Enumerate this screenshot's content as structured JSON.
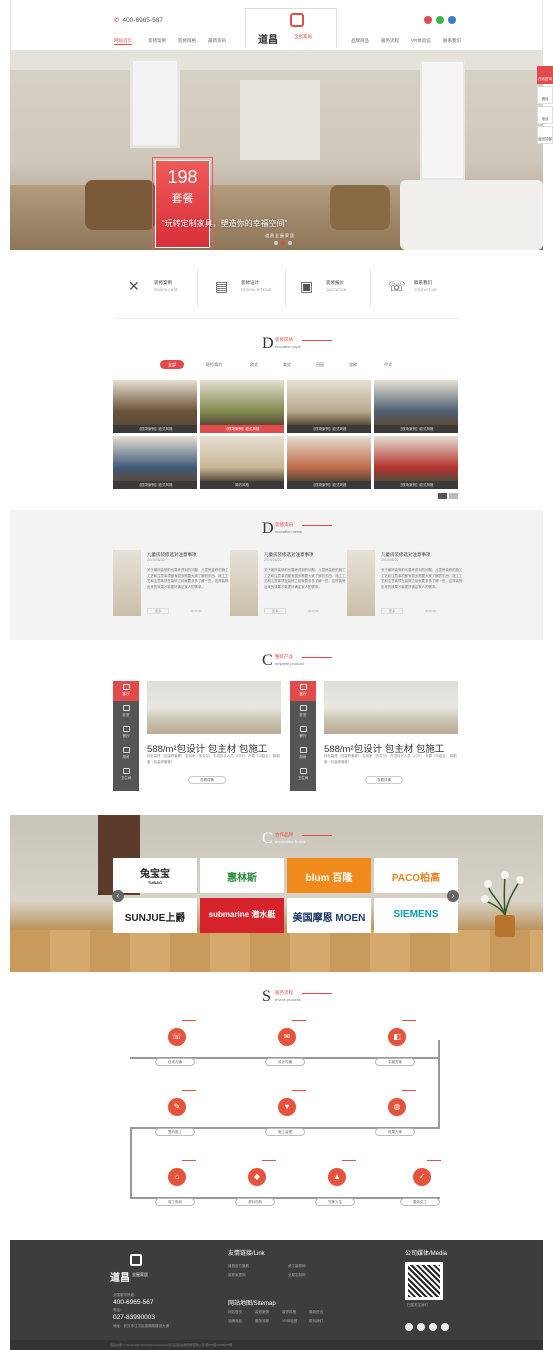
{
  "header": {
    "phone": "400-6965-567",
    "logo_text": "道昌",
    "logo_sub": "全屋家居",
    "nav_left": [
      "网站首页",
      "装修案例",
      "装修风格",
      "最新资讯"
    ],
    "nav_right": [
      "品牌商品",
      "服务流程",
      "VR体验馆",
      "联系我们"
    ],
    "social_colors": [
      "#e24b4b",
      "#3bb54a",
      "#3a7bd5"
    ]
  },
  "hero": {
    "promo_number": "198",
    "promo_text": "套餐",
    "slogan": "“玩转定制家具，塑造你的幸福空间”",
    "slogan_sub": "道昌全屋家居",
    "side_tools": [
      "在线咨询",
      "微信",
      "电话",
      "返回顶部"
    ]
  },
  "features": [
    {
      "icon": "✕",
      "title": "装修案例",
      "sub": "DESIGN CASE"
    },
    {
      "icon": "▤",
      "title": "装修设计",
      "sub": "DESIGN OPTIONS"
    },
    {
      "icon": "▣",
      "title": "装修报价",
      "sub": "QUOTATION"
    },
    {
      "icon": "☏",
      "title": "联系我们",
      "sub": "CONTACT US"
    }
  ],
  "style_section": {
    "letter": "D",
    "cn": "装修风格",
    "en": "ecoration style",
    "tabs": [
      "全部",
      "现代/简约",
      "欧式",
      "美式",
      "田园",
      "北欧",
      "中式"
    ],
    "items": [
      {
        "caption": "【现场案例】欧式风格",
        "color": "#6a5338"
      },
      {
        "caption": "【现场案例】欧式风格",
        "color": "#7f8a4e"
      },
      {
        "caption": "【现场案例】欧式风格",
        "color": "#b9a98d"
      },
      {
        "caption": "【现场案例】欧式风格",
        "color": "#4f5f74"
      },
      {
        "caption": "【现场案例】欧式风格",
        "color": "#3f5a7a"
      },
      {
        "caption": "简约风格",
        "color": "#c8b795"
      },
      {
        "caption": "【现场案例】欧式风格",
        "color": "#c06a4a"
      },
      {
        "caption": "【现场案例】欧式风格",
        "color": "#b3342e"
      }
    ]
  },
  "news_section": {
    "letter": "D",
    "cn": "装修资讯",
    "en": "ecoration news",
    "items": [
      {
        "title": "儿童房装修选对注意事项",
        "date": "2015/05/20",
        "desc": "关于最好装修前也要考虑到的问题，儿童房装修的施工工艺和注意事项都有很多需要大家了解的东西，施工工艺和注意事项在装修之前就要多多了解一些，这样装修出来的效果才能更好满足家人的需求。",
        "more": "更多",
        "meta": "2015   99"
      },
      {
        "title": "儿童房装修选对注意事项",
        "date": "2015/05/20",
        "desc": "关于最好装修前也要考虑到的问题，儿童房装修的施工工艺和注意事项都有很多需要大家了解的东西，施工工艺和注意事项在装修之前就要多多了解一些，这样装修出来的效果才能更好满足家人的需求。",
        "more": "更多",
        "meta": "2015   99"
      },
      {
        "title": "儿童房装修选对注意事项",
        "date": "2015/05/20",
        "desc": "关于最好装修前也要考虑到的问题，儿童房装修的施工工艺和注意事项都有很多需要大家了解的东西，施工工艺和注意事项在装修之前就要多多了解一些，这样装修出来的效果才能更好满足家人的需求。",
        "more": "更多",
        "meta": "2015   99"
      }
    ]
  },
  "product_section": {
    "letter": "C",
    "cn": "整装产品",
    "en": "omplete product",
    "menu": [
      "客厅",
      "卧室",
      "餐厅",
      "厨房",
      "卫生间"
    ],
    "items": [
      {
        "headline": "588/m²包设计 包主材 包施工",
        "desc": "特色装修（包装修套餐） 名品家（多芬尔） 先进设计人员（门厅）  布置（可组合）  精细做（包装修套餐）",
        "button": "查看详情"
      },
      {
        "headline": "588/m²包设计 包主材 包施工",
        "desc": "特色装修（包装修套餐） 名品家（多芬尔） 先进设计人员（门厅）  布置（可组合）  精细做（包装修套餐）",
        "button": "查看详情"
      }
    ]
  },
  "partner_section": {
    "letter": "C",
    "cn": "合作品牌",
    "en": "ooperation brand",
    "brands": [
      {
        "name": "兔宝宝",
        "sub": "TUBAO",
        "color": "#222",
        "bg": "#fff"
      },
      {
        "name": "惠林斯",
        "sub": "",
        "color": "#2a8a3a",
        "bg": "#fff"
      },
      {
        "name": "blum 百隆",
        "sub": "",
        "color": "#fff",
        "bg": "#f08a1c"
      },
      {
        "name": "PACO柏高",
        "sub": "",
        "color": "#e8831d",
        "bg": "#fff"
      },
      {
        "name": "SUNJUE上爵",
        "sub": "",
        "color": "#222",
        "bg": "#fff"
      },
      {
        "name": "submarine 潜水艇",
        "sub": "",
        "color": "#fff",
        "bg": "#d6232b"
      },
      {
        "name": "美国摩恩 MOEN",
        "sub": "",
        "color": "#1b3a6b",
        "bg": "#fff"
      },
      {
        "name": "SIEMENS",
        "sub": "",
        "color": "#0e9aa7",
        "bg": "#fff"
      }
    ]
  },
  "service_section": {
    "letter": "S",
    "cn": "服务流程",
    "en": "ervice process",
    "steps": [
      "在线沟通",
      "设计沟通",
      "平面方案",
      "签约施工",
      "施工监理",
      "效果方案",
      "竣工验收",
      "资料归档",
      "完美入住",
      "整体交工"
    ]
  },
  "footer": {
    "logo_text": "道昌",
    "logo_sub": "全屋家居",
    "hotline_label": "全国服务热线：",
    "hotline": "400-6965-567",
    "tel_label": "电话：",
    "tel": "027-83990003",
    "address": "地址：武汉市江汉区香港路建设大道",
    "links_title": "友情链接/Link",
    "links": [
      "道昌官方旗舰",
      "武汉装修网",
      "装修家居网",
      "全屋定制网"
    ],
    "sitemap_title": "网站地图/Sitemap",
    "sitemap": [
      "网站首页",
      "装修案例",
      "装修风格",
      "最新资讯",
      "品牌商品",
      "服务流程",
      "VR体验馆",
      "联系我们"
    ],
    "media_title": "公司媒体/Media",
    "qr_caption": "扫描关注我们",
    "copyright": "道昌全屋 © 2015-2016 All Rights Reserved  武汉道昌全屋家居有限公司 鄂ICP备12345678号"
  }
}
